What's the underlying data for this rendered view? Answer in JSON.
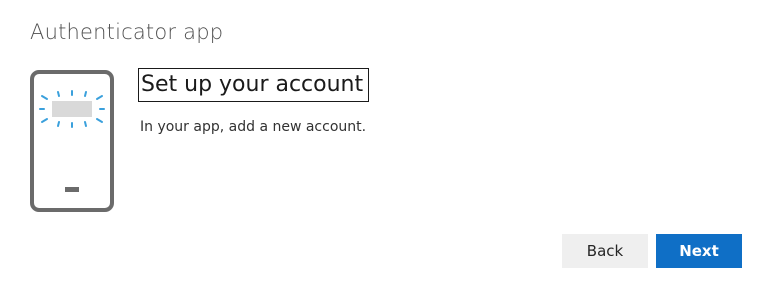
{
  "header": {
    "app_title": "Authenticator app"
  },
  "step": {
    "title": "Set up your account",
    "description": "In your app, add a new account."
  },
  "actions": {
    "back_label": "Back",
    "next_label": "Next"
  },
  "colors": {
    "accent": "#0f6fc6",
    "phone_outline": "#6b6b6b",
    "sparkle": "#3aa0dc"
  },
  "icons": {
    "illustration": "phone-with-qr-code-icon"
  }
}
